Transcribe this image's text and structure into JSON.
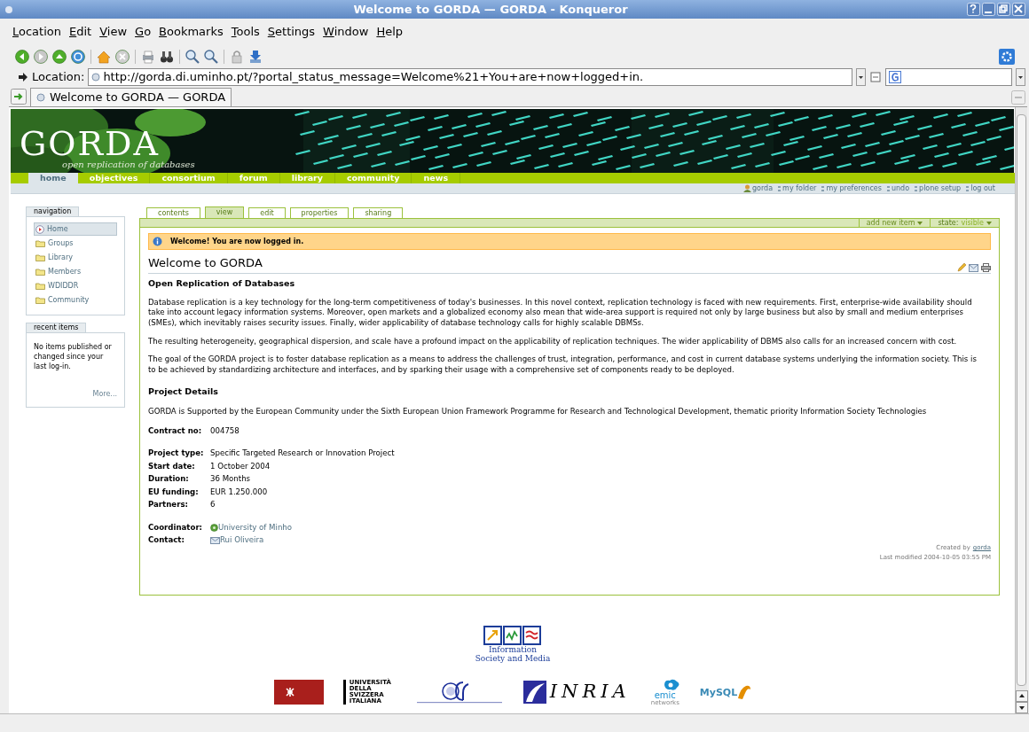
{
  "window": {
    "title": "Welcome to GORDA — GORDA - Konqueror"
  },
  "menu": [
    "Location",
    "Edit",
    "View",
    "Go",
    "Bookmarks",
    "Tools",
    "Settings",
    "Window",
    "Help"
  ],
  "location": {
    "label": "Location:",
    "value": "http://gorda.di.uminho.pt/?portal_status_message=Welcome%21+You+are+now+logged+in."
  },
  "browser_tabs": [
    {
      "label": "Welcome to GORDA — GORDA",
      "selected": true
    }
  ],
  "site": {
    "logo": "GORDA",
    "tagline": "open replication of databases",
    "nav": [
      {
        "label": "home",
        "selected": true
      },
      {
        "label": "objectives",
        "selected": false
      },
      {
        "label": "consortium",
        "selected": false
      },
      {
        "label": "forum",
        "selected": false
      },
      {
        "label": "library",
        "selected": false
      },
      {
        "label": "community",
        "selected": false
      },
      {
        "label": "news",
        "selected": false
      }
    ],
    "user_actions": [
      {
        "label": "gorda",
        "kind": "user"
      },
      {
        "label": "my folder",
        "kind": "link"
      },
      {
        "label": "my preferences",
        "kind": "link"
      },
      {
        "label": "undo",
        "kind": "link"
      },
      {
        "label": "plone setup",
        "kind": "link"
      },
      {
        "label": "log out",
        "kind": "link"
      }
    ]
  },
  "navigation": {
    "title": "navigation",
    "items": [
      {
        "label": "Home",
        "kind": "home",
        "selected": true
      },
      {
        "label": "Groups",
        "kind": "folder",
        "selected": false
      },
      {
        "label": "Library",
        "kind": "folder",
        "selected": false
      },
      {
        "label": "Members",
        "kind": "folder",
        "selected": false
      },
      {
        "label": "WDIDDR",
        "kind": "folder",
        "selected": false
      },
      {
        "label": "Community",
        "kind": "folder",
        "selected": false
      }
    ]
  },
  "recent_items": {
    "title": "recent items",
    "text": "No items published or changed since your last log-in.",
    "more": "More..."
  },
  "content_tabs": [
    {
      "label": "contents",
      "selected": false
    },
    {
      "label": "view",
      "selected": true
    },
    {
      "label": "edit",
      "selected": false
    },
    {
      "label": "properties",
      "selected": false
    },
    {
      "label": "sharing",
      "selected": false
    }
  ],
  "content_actions": {
    "add": "add new item",
    "state_label": "state:",
    "state": "visible"
  },
  "status_message": "Welcome! You are now logged in.",
  "document": {
    "title": "Welcome to GORDA",
    "description": "Open Replication of Databases",
    "body": [
      {
        "kind": "p",
        "text": "Database replication is a key technology for the long-term competitiveness of today's businesses. In this novel context, replication technology is faced with new requirements. First, enterprise-wide availability should take into account legacy information systems. Moreover, open markets and a globalized economy also mean that wide-area support is required not only by large business but also by small and medium enterprises (SMEs), which inevitably raises security issues. Finally, wider applicability of database technology calls for highly scalable DBMSs."
      },
      {
        "kind": "p",
        "text": "The resulting heterogeneity, geographical dispersion, and scale have a profound impact on the applicability of replication techniques. The wider applicability of DBMS also calls for an increased concern with cost."
      },
      {
        "kind": "p",
        "text": "The goal of the GORDA project is to foster database replication as a means to address the challenges of trust, integration, performance, and cost in current database systems underlying the information society. This is to be achieved by standardizing architecture and interfaces, and by sparking their usage with a comprehensive set of components ready to be deployed."
      },
      {
        "kind": "h",
        "text": "Project Details"
      },
      {
        "kind": "p",
        "text": "GORDA is Supported by the European Community under the Sixth European Union Framework Programme for Research and Technological Development, thematic priority Information Society Technologies"
      }
    ],
    "details": [
      [
        {
          "label": "Contract no:",
          "value": "004758",
          "kind": "text"
        }
      ],
      [
        {
          "label": "Project type:",
          "value": "Specific Targeted Research or Innovation Project",
          "kind": "text"
        },
        {
          "label": "Start date:",
          "value": "1 October 2004",
          "kind": "text"
        },
        {
          "label": "Duration:",
          "value": "36 Months",
          "kind": "text"
        },
        {
          "label": "EU funding:",
          "value": "EUR 1.250.000",
          "kind": "text"
        },
        {
          "label": "Partners:",
          "value": "6",
          "kind": "text"
        }
      ],
      [
        {
          "label": "Coordinator:",
          "value": "University of Minho",
          "kind": "web"
        },
        {
          "label": "Contact:",
          "value": "Rui Oliveira",
          "kind": "mail"
        }
      ]
    ],
    "created_by": "Created by",
    "creator": "gorda",
    "last_modified": "Last modified 2004-10-05 03:55 PM"
  },
  "footer": {
    "ist": "Information Society and Media",
    "usi": "UNIVERSITÀ DELLA SVIZZERA ITALIANA",
    "inria": "INRIA",
    "emic": "emic",
    "emic_sub": "networks",
    "mysql": "MySQL"
  }
}
